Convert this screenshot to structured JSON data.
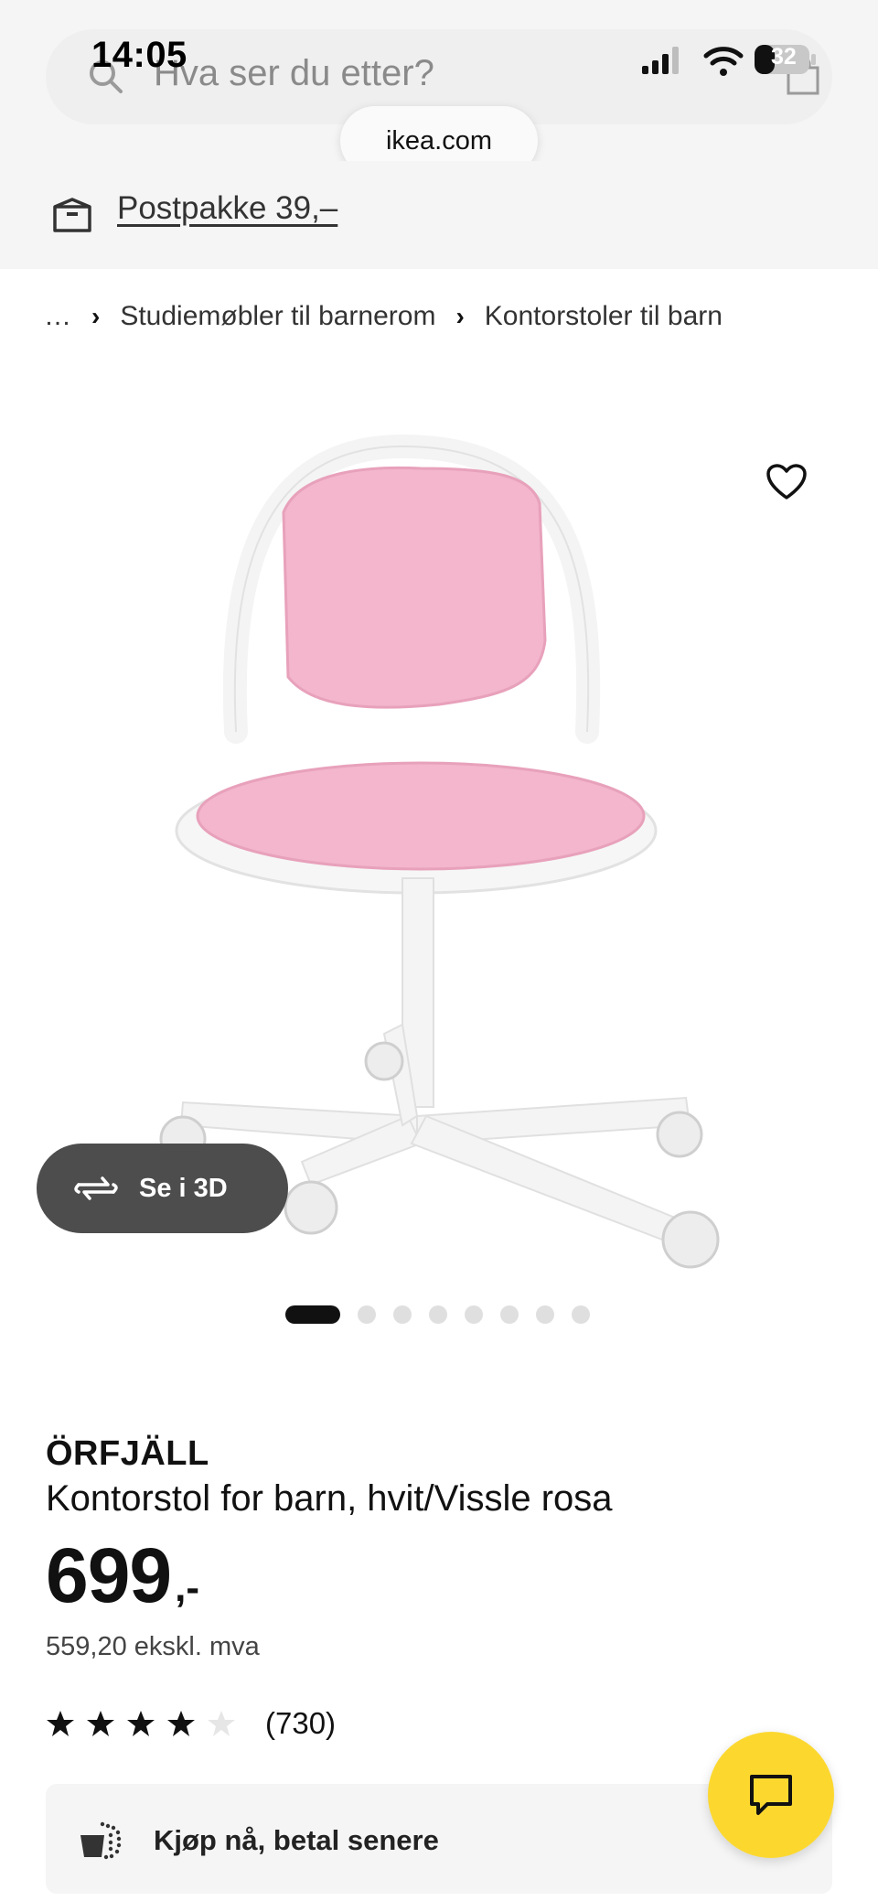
{
  "status_bar": {
    "time": "14:05",
    "battery": "32"
  },
  "search": {
    "placeholder": "Hva ser du etter?",
    "url": "ikea.com"
  },
  "banner": {
    "text": "Postpakke 39,–"
  },
  "breadcrumb": {
    "items": [
      "…",
      "Studiemøbler til barnerom",
      "Kontorstoler til barn"
    ]
  },
  "gallery": {
    "view_3d_label": "Se i 3D",
    "image_count": 8,
    "active_index": 0
  },
  "product": {
    "brand": "ÖRFJÄLL",
    "description": "Kontorstol for barn, hvit/Vissle rosa",
    "price": "699",
    "price_suffix": ",-",
    "price_excl_vat": "559,20 ekskl. mva",
    "rating": 4,
    "rating_max": 5,
    "review_count": "(730)"
  },
  "payment": {
    "label": "Kjøp nå, betal senere"
  },
  "colors": {
    "accent_yellow": "#fcd82f",
    "seat_pink": "#f3b6cc",
    "frame_white": "#ffffff",
    "dark_button": "#4d4d4d"
  }
}
